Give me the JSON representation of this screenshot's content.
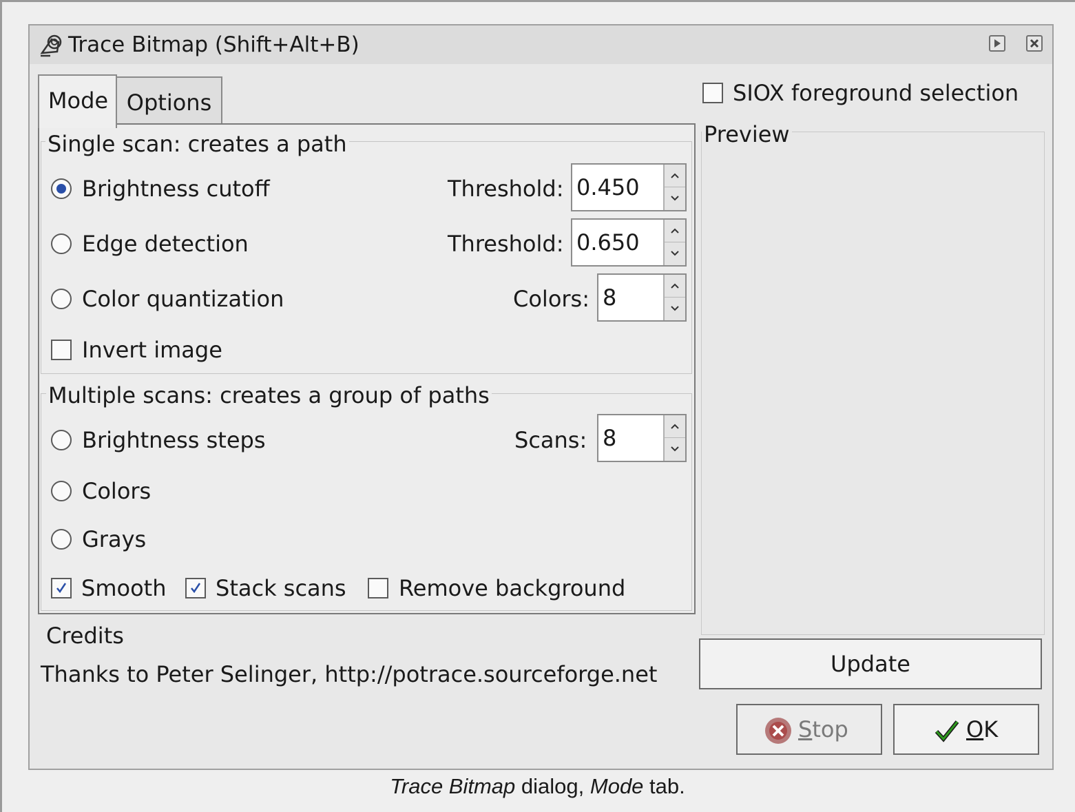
{
  "window": {
    "title": "Trace Bitmap (Shift+Alt+B)",
    "icon": "trace-bitmap-icon"
  },
  "tabs": [
    {
      "label": "Mode",
      "active": true
    },
    {
      "label": "Options",
      "active": false
    }
  ],
  "single_scan": {
    "legend": "Single scan: creates a path",
    "brightness": {
      "label": "Brightness cutoff",
      "selected": true,
      "param_label": "Threshold:",
      "value": "0.450"
    },
    "edge": {
      "label": "Edge detection",
      "selected": false,
      "param_label": "Threshold:",
      "value": "0.650"
    },
    "color_quant": {
      "label": "Color quantization",
      "selected": false,
      "param_label": "Colors:",
      "value": "8"
    },
    "invert": {
      "label": "Invert image",
      "checked": false
    }
  },
  "multiple_scans": {
    "legend": "Multiple scans: creates a group of paths",
    "brightness_steps": {
      "label": "Brightness steps",
      "selected": false,
      "param_label": "Scans:",
      "value": "8"
    },
    "colors": {
      "label": "Colors",
      "selected": false
    },
    "grays": {
      "label": "Grays",
      "selected": false
    },
    "smooth": {
      "label": "Smooth",
      "checked": true
    },
    "stack": {
      "label": "Stack scans",
      "checked": true
    },
    "remove_bg": {
      "label": "Remove background",
      "checked": false
    }
  },
  "credits": {
    "heading": "Credits",
    "text": "Thanks to Peter Selinger, http://potrace.sourceforge.net"
  },
  "siox": {
    "label": "SIOX foreground selection",
    "checked": false
  },
  "preview": {
    "legend": "Preview"
  },
  "buttons": {
    "update": "Update",
    "stop_mnemonic": "S",
    "stop_rest": "top",
    "ok_mnemonic": "O",
    "ok_rest": "K"
  },
  "caption": {
    "part1": "Trace Bitmap",
    "part2": " dialog, ",
    "part3": "Mode",
    "part4": " tab."
  },
  "colors": {
    "radio_dot": "#2a4fa8",
    "check_mark": "#2a4fa8",
    "ok_check": "#2e9a1e",
    "stop_icon": "#8a1c1c"
  }
}
